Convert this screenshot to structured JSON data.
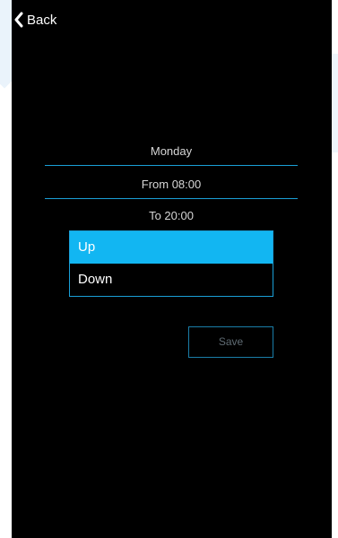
{
  "colors": {
    "screen_background": "#000000",
    "accent": "#12b6f2",
    "rule": "#1a9fd6",
    "text": "#ffffff",
    "muted_text": "#d6d6d6",
    "disabled_text": "#5f6b73"
  },
  "nav": {
    "back_label": "Back",
    "back_icon": "chevron-left-icon"
  },
  "schedule": {
    "day": "Monday",
    "from": "From 08:00",
    "to": "To 20:00"
  },
  "direction": {
    "options": [
      "Up",
      "Down"
    ],
    "selected": "Up"
  },
  "actions": {
    "save_label": "Save"
  }
}
